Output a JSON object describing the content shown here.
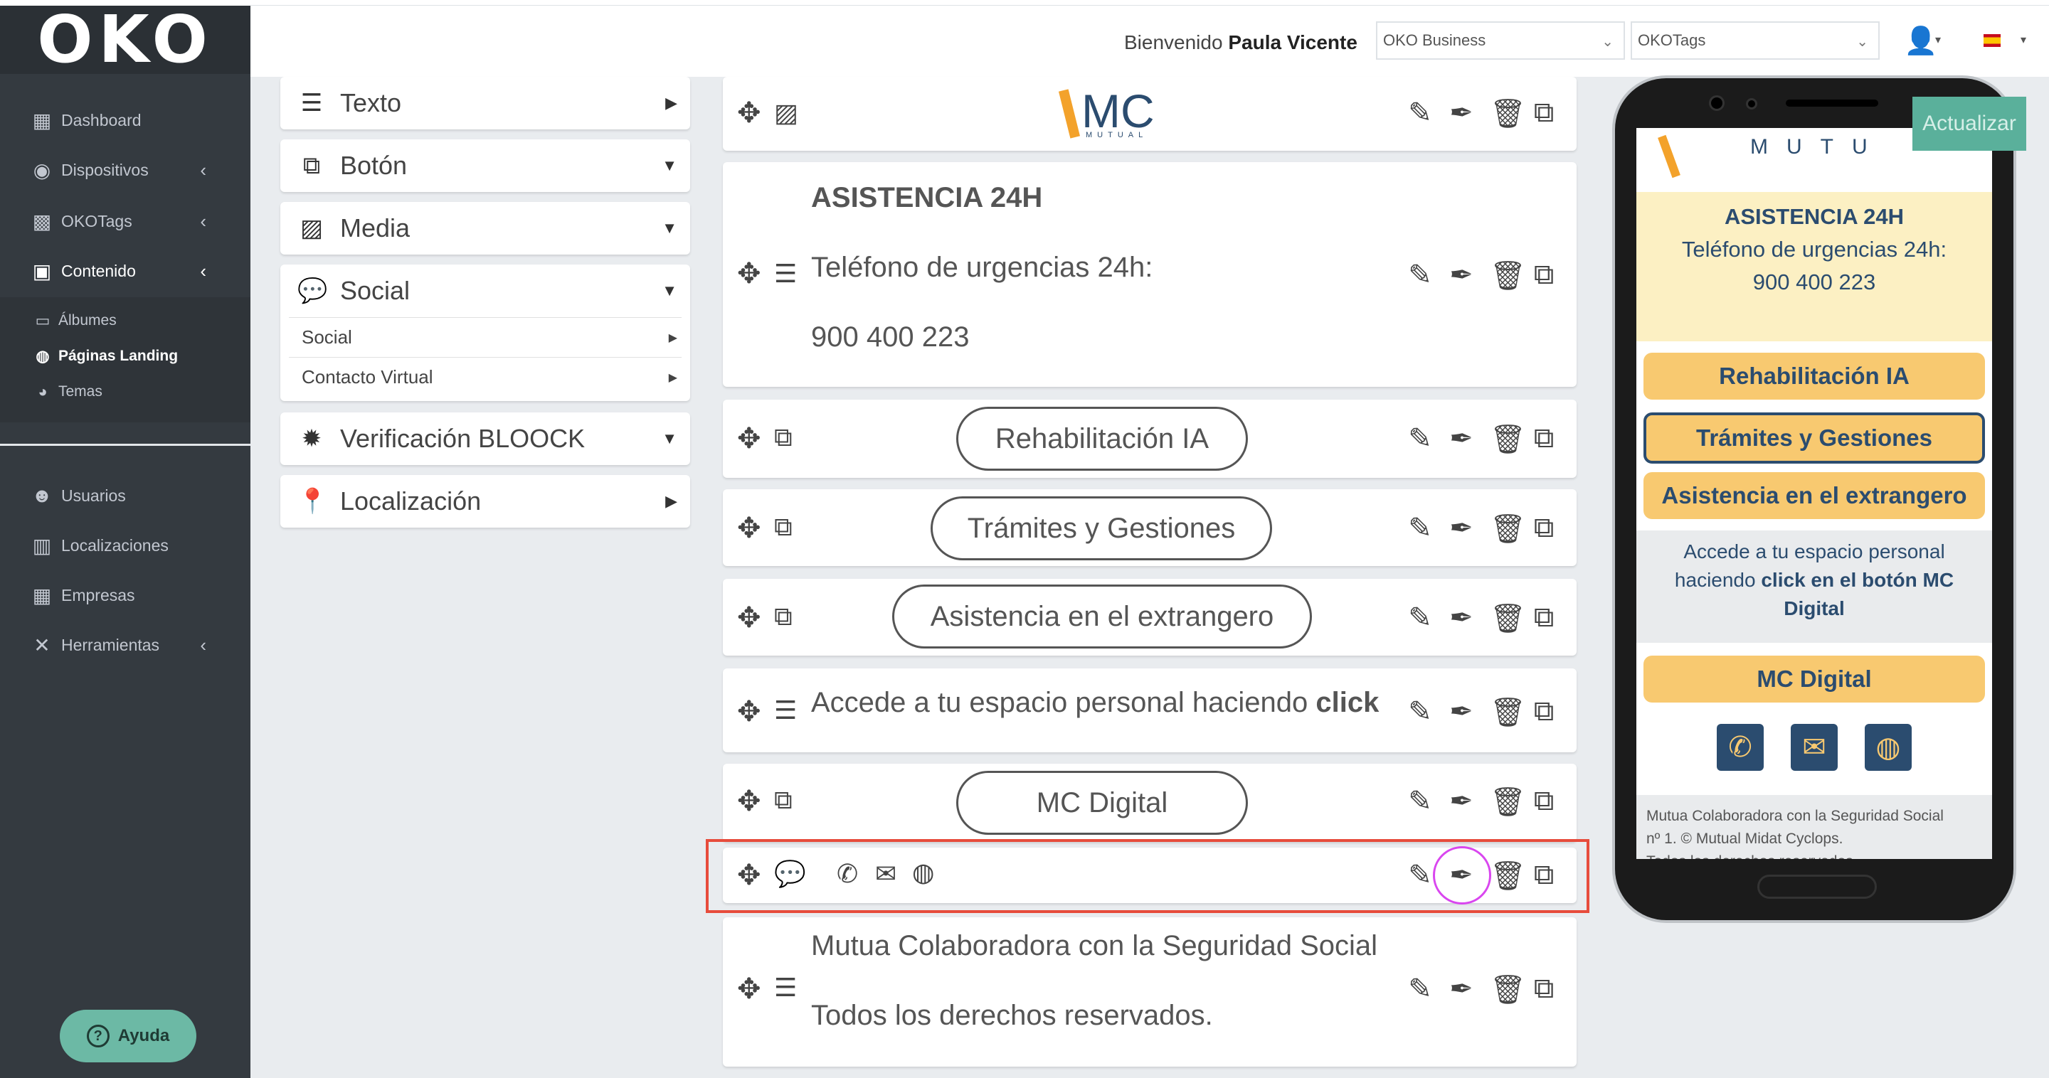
{
  "sidebar": {
    "logo": "OKO",
    "items": [
      {
        "label": "Dashboard",
        "icon": "building-icon"
      },
      {
        "label": "Dispositivos",
        "icon": "target-icon"
      },
      {
        "label": "OKOTags",
        "icon": "qr-icon"
      },
      {
        "label": "Contenido",
        "icon": "image-icon"
      },
      {
        "label": "Usuarios",
        "icon": "users-icon"
      },
      {
        "label": "Localizaciones",
        "icon": "city-icon"
      },
      {
        "label": "Empresas",
        "icon": "building-icon"
      },
      {
        "label": "Herramientas",
        "icon": "tools-icon"
      }
    ],
    "subitems": [
      {
        "label": "Álbumes",
        "icon": "album-icon"
      },
      {
        "label": "Páginas Landing",
        "icon": "globe-icon"
      },
      {
        "label": "Temas",
        "icon": "palette-icon"
      }
    ],
    "help_label": "Ayuda"
  },
  "topbar": {
    "welcome_prefix": "Bienvenido",
    "user_name": "Paula Vicente",
    "business_select": "OKO Business",
    "tags_select": "OKOTags"
  },
  "components": {
    "texto": "Texto",
    "boton": "Botón",
    "media": "Media",
    "social": "Social",
    "social_sub1": "Social",
    "social_sub2": "Contacto Virtual",
    "verificacion": "Verificación BLOOCK",
    "localizacion": "Localización"
  },
  "builder": {
    "logo_text": "MC",
    "logo_sub": "MUTUAL",
    "asistencia_title": "ASISTENCIA 24H",
    "asistencia_line1": "Teléfono de urgencias 24h:",
    "asistencia_line2": "900 400 223",
    "btn1": "Rehabilitación IA",
    "btn2": "Trámites y Gestiones",
    "btn3": "Asistencia en el extrangero",
    "access_text": "Accede a tu espacio personal haciendo ",
    "access_bold": "click",
    "btn4": "MC Digital",
    "footer_line1": "Mutua Colaboradora con la Seguridad Social",
    "footer_line2": "Todos los derechos reservados."
  },
  "preview": {
    "update_label": "Actualizar",
    "logo_fragment": "MUTU",
    "asistencia_title": "ASISTENCIA 24H",
    "asistencia_line1": "Teléfono de urgencias 24h:",
    "asistencia_line2": "900 400 223",
    "btn1": "Rehabilitación IA",
    "btn2": "Trámites y Gestiones",
    "btn3": "Asistencia en el extrangero",
    "access_line1": "Accede a tu espacio personal",
    "access_line2_prefix": "haciendo ",
    "access_line2_bold": "click en el botón MC",
    "access_line3_bold": "Digital",
    "btn4": "MC Digital",
    "footer_line1": "Mutua Colaboradora con la Seguridad Social",
    "footer_line2": "nº 1. © Mutual Midat Cyclops.",
    "footer_line3": "Todos los derechos reservados."
  },
  "colors": {
    "sidebar_bg": "#343a40",
    "accent_teal": "#5ab09b",
    "brand_navy": "#2b4c6f",
    "brand_yellow": "#f8c970",
    "highlight_red": "#e74c3c",
    "highlight_pink": "#d946ef"
  }
}
